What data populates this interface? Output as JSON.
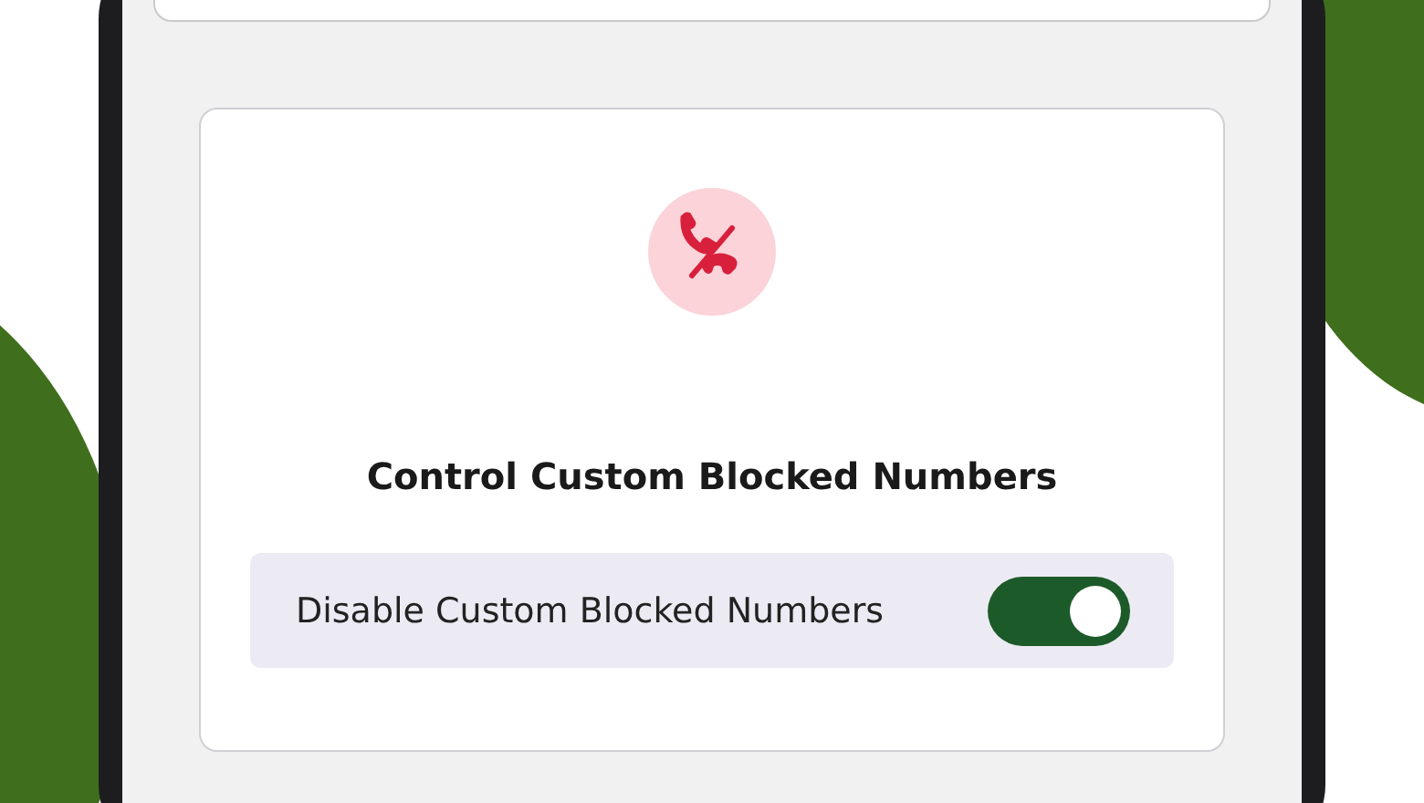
{
  "card": {
    "title": "Control Custom Blocked Numbers"
  },
  "setting": {
    "label": "Disable Custom Blocked Numbers",
    "on": true
  }
}
